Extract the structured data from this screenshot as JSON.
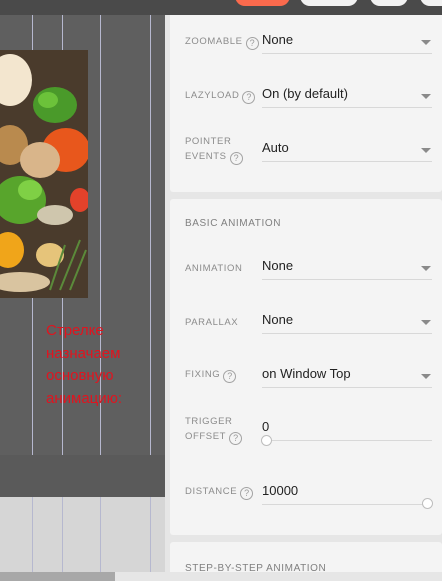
{
  "canvas": {
    "note_text": "Стрелке назначаем основную анимацию:",
    "note_color": "#e0141f",
    "image_icon": "food-photo"
  },
  "panel": {
    "zoomable": {
      "label": "ZOOMABLE",
      "value": "None"
    },
    "lazyload": {
      "label": "LAZYLOAD",
      "value": "On (by default)"
    },
    "pointer_events": {
      "label_line1": "POINTER",
      "label_line2": "EVENTS",
      "value": "Auto"
    },
    "basic_animation": {
      "title": "BASIC ANIMATION",
      "animation": {
        "label": "ANIMATION",
        "value": "None"
      },
      "parallax": {
        "label": "PARALLAX",
        "value": "None"
      },
      "fixing": {
        "label": "FIXING",
        "value": "on Window Top"
      },
      "trigger_offset": {
        "label_line1": "TRIGGER",
        "label_line2": "OFFSET",
        "value": "0",
        "level": 0
      },
      "distance": {
        "label": "DISTANCE",
        "value": "10000",
        "level": 1
      }
    },
    "step_by_step": {
      "title": "STEP-BY-STEP ANIMATION"
    },
    "help_glyph": "?"
  },
  "colors": {
    "accent_button": "#fa6a4d",
    "panel_bg": "#f4f4f4",
    "canvas_bg": "#5f5f5f"
  }
}
